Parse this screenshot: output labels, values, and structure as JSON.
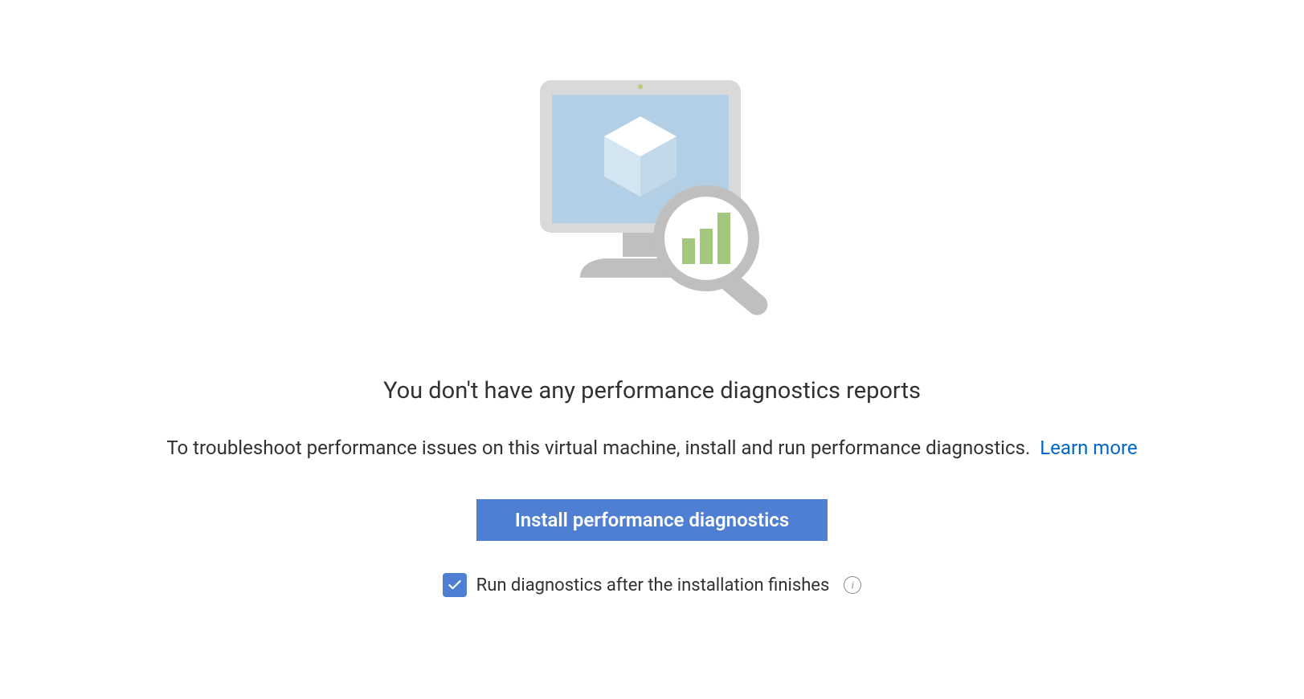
{
  "emptyState": {
    "heading": "You don't have any performance diagnostics reports",
    "description": "To troubleshoot performance issues on this virtual machine, install and run performance diagnostics.",
    "learnMoreLabel": "Learn more",
    "installButtonLabel": "Install performance diagnostics",
    "checkbox": {
      "checked": true,
      "label": "Run diagnostics after the installation finishes"
    }
  }
}
